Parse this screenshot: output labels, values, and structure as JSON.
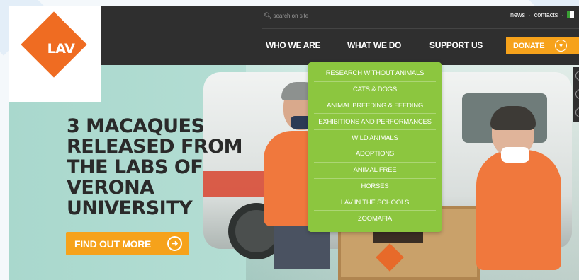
{
  "brand": {
    "logo_text": "LAV",
    "color": "#ef6c22"
  },
  "search": {
    "placeholder": "search on site",
    "icon": "search-icon"
  },
  "utility": {
    "news": "news",
    "contacts": "contacts",
    "separator": "·"
  },
  "nav": {
    "items": [
      {
        "label": "WHO WE ARE"
      },
      {
        "label": "WHAT WE DO"
      },
      {
        "label": "SUPPORT US"
      }
    ],
    "donate_label": "DONATE",
    "donate_icon": "heart-icon"
  },
  "dropdown": {
    "bg": "#8cc63f",
    "items": [
      "RESEARCH WITHOUT ANIMALS",
      "CATS & DOGS",
      "ANIMAL BREEDING & FEEDING",
      "EXHIBITIONS AND PERFORMANCES",
      "WILD ANIMALS",
      "ADOPTIONS",
      "ANIMAL FREE",
      "HORSES",
      "LAV IN THE SCHOOLS",
      "ZOOMAFIA"
    ]
  },
  "hero": {
    "headline_lines": [
      "3 MACAQUES",
      "RELEASED FROM",
      "THE LABS OF",
      "VERONA",
      "UNIVERSITY"
    ],
    "cta_label": "FIND OUT MORE",
    "cta_icon": "arrow-right-circle-icon",
    "accent": "#f6a21b"
  }
}
